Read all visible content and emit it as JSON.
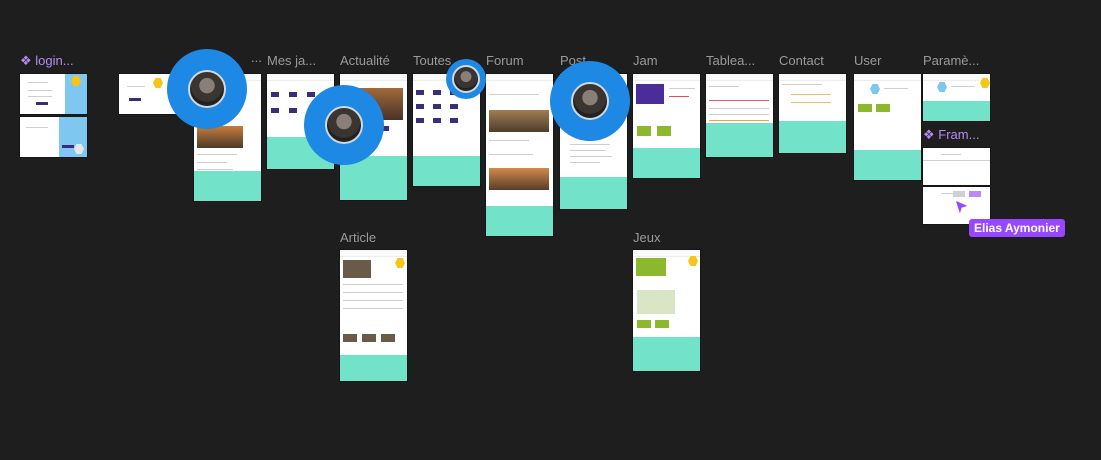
{
  "canvas": {
    "background": "#1e1e1e",
    "labels": {
      "login": "❖ login...",
      "frame_truncated": "...",
      "mes_jeux": "Mes ja...",
      "actualite": "Actualité",
      "toutes": "Toutes",
      "forum": "Forum",
      "post": "Post",
      "jam": "Jam",
      "tableau": "Tablea...",
      "contact": "Contact",
      "user": "User",
      "parametres": "Paramè...",
      "frame_component": "❖ Fram...",
      "article": "Article",
      "jeux": "Jeux"
    }
  },
  "collaborator": {
    "name": "Elias Aymonier",
    "color": "#9747ff"
  },
  "colors": {
    "footer": "#72e3c9",
    "accent_yellow": "#f5c518",
    "avatar_blue": "#1e88e5"
  }
}
